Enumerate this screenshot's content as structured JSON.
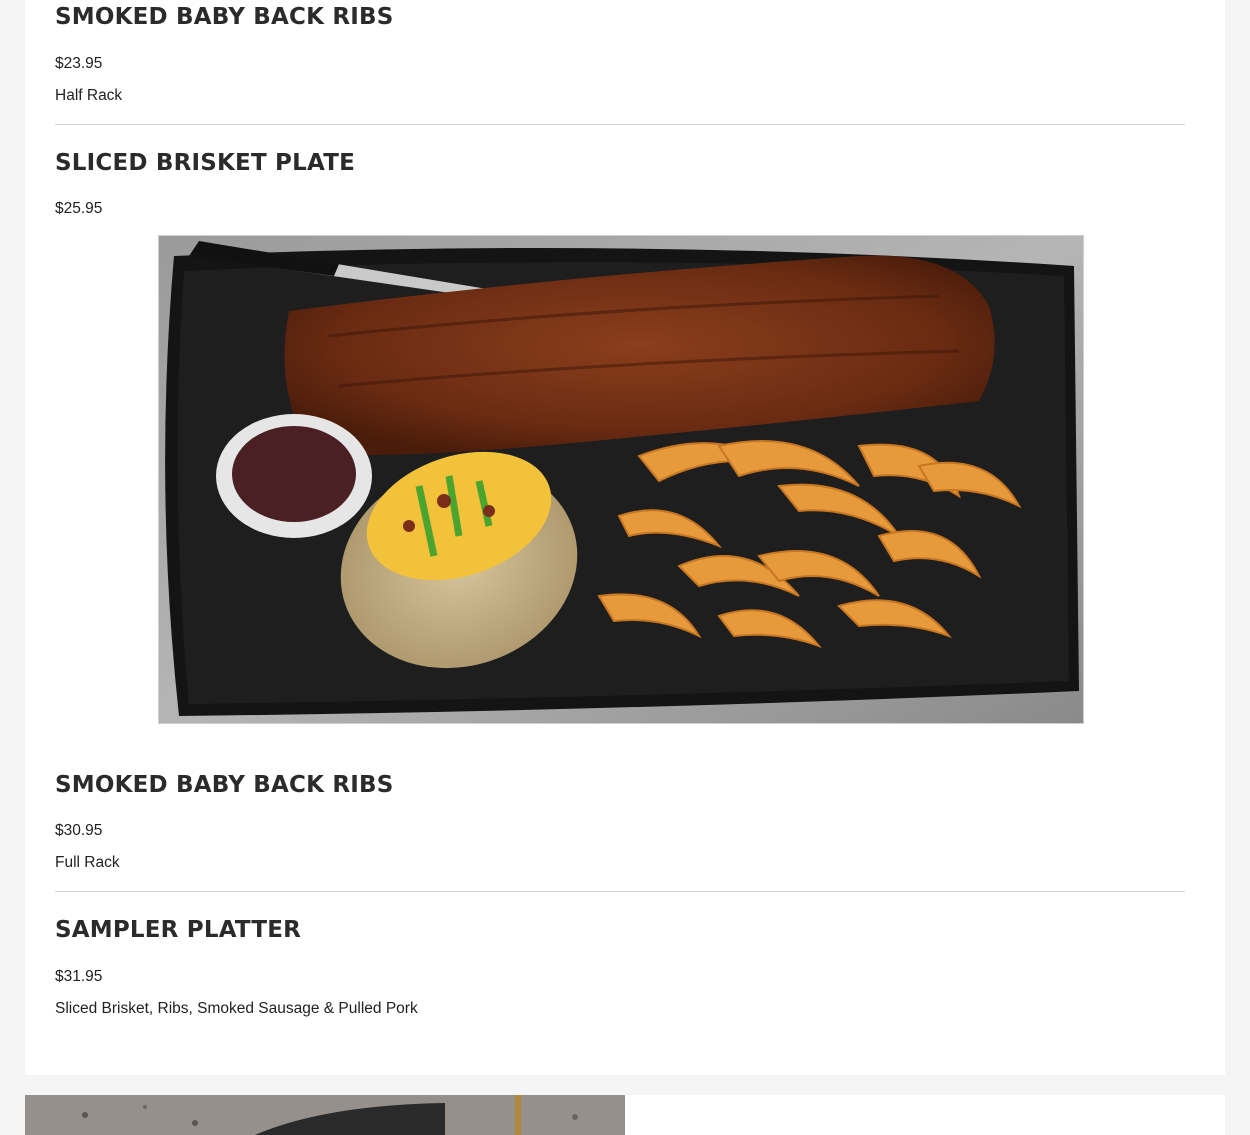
{
  "menu_items": [
    {
      "title": "SMOKED BABY BACK RIBS",
      "price": "$23.95",
      "description": "Half Rack"
    },
    {
      "title": "SLICED BRISKET PLATE",
      "price": "$25.95"
    },
    {
      "title": "SMOKED BABY BACK RIBS",
      "price": "$30.95",
      "description": "Full Rack"
    },
    {
      "title": "SAMPLER PLATTER",
      "price": "$31.95",
      "description": "Sliced Brisket, Ribs, Smoked Sausage & Pulled Pork"
    }
  ],
  "colors": {
    "page_background": "#f5f5f5",
    "card_background": "#ffffff",
    "title_color": "#2b2b2b",
    "text_color": "#222222",
    "divider_color": "#cfcfcf"
  }
}
